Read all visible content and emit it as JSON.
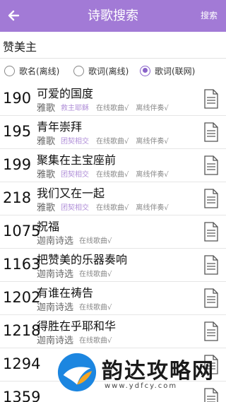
{
  "header": {
    "title": "诗歌搜索",
    "search_label": "搜索",
    "bg_color": "#a27ad6"
  },
  "search": {
    "value": "赞美主"
  },
  "options": [
    {
      "label": "歌名(离线)",
      "checked": false
    },
    {
      "label": "歌词(离线)",
      "checked": false
    },
    {
      "label": "歌词(联网)",
      "checked": true
    }
  ],
  "results": [
    {
      "num": "190",
      "title": "可爱的国度",
      "source": "雅歌",
      "author": "救主耶稣",
      "tags": [
        "在线歌曲√",
        "离线伴奏√"
      ]
    },
    {
      "num": "195",
      "title": "青年崇拜",
      "source": "雅歌",
      "author": "团契相交",
      "tags": [
        "在线歌曲√",
        "离线伴奏√"
      ]
    },
    {
      "num": "199",
      "title": "聚集在主宝座前",
      "source": "雅歌",
      "author": "团契相交",
      "tags": [
        "在线歌曲√",
        "离线伴奏√"
      ]
    },
    {
      "num": "218",
      "title": "我们又在一起",
      "source": "雅歌",
      "author": "团契相交",
      "tags": [
        "在线歌曲√",
        "离线伴奏√"
      ]
    },
    {
      "num": "1075",
      "title": "祝福",
      "source": "迦南诗选",
      "author": "",
      "tags": [
        "在线歌曲√"
      ]
    },
    {
      "num": "1163",
      "title": "把赞美的乐器奏响",
      "source": "迦南诗选",
      "author": "",
      "tags": [
        "在线歌曲√"
      ]
    },
    {
      "num": "1202",
      "title": "有谁在祷告",
      "source": "迦南诗选",
      "author": "",
      "tags": [
        "在线歌曲√"
      ]
    },
    {
      "num": "1218",
      "title": "得胜在乎耶和华",
      "source": "迦南诗选",
      "author": "",
      "tags": [
        "在线歌曲√"
      ]
    },
    {
      "num": "1294",
      "title": "",
      "source": "",
      "author": "",
      "tags": []
    },
    {
      "num": "1359",
      "title": "",
      "source": "",
      "author": "",
      "tags": []
    }
  ],
  "watermark": {
    "brand": "韵达攻略网",
    "url": "www.ydfcy.com"
  }
}
